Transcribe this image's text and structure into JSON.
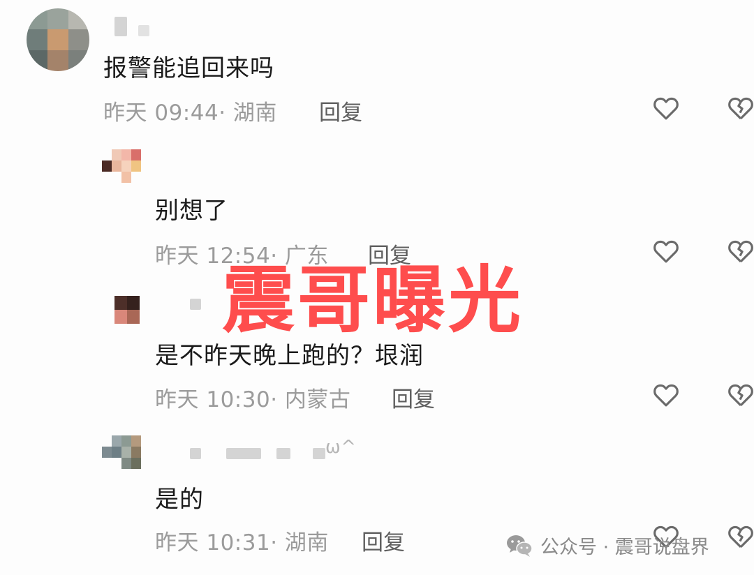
{
  "overlay": {
    "label": "震哥曝光",
    "color": "#ff3b3b"
  },
  "watermark": {
    "icon": "wechat-icon",
    "text": "公众号 · 震哥说盘界"
  },
  "actions": {
    "like_icon": "heart-outline-icon",
    "dislike_icon": "broken-heart-icon"
  },
  "comments": [
    {
      "text": "报警能追回来吗",
      "time": "昨天 09:44",
      "location": "湖南",
      "meta": "昨天 09:44· 湖南",
      "reply_label": "回复",
      "username": ""
    },
    {
      "text": "别想了",
      "time": "昨天 12:54",
      "location": "广东",
      "meta": "昨天 12:54· 广东",
      "reply_label": "回复",
      "username": ""
    },
    {
      "text": "是不昨天晚上跑的？垠润",
      "time": "昨天 10:30",
      "location": "内蒙古",
      "meta": "昨天 10:30· 内蒙古",
      "reply_label": "回复",
      "username": ""
    },
    {
      "text": "是的",
      "time": "昨天 10:31",
      "location": "湖南",
      "meta": "昨天 10:31· 湖南",
      "reply_label": "回复",
      "username": "ω^"
    }
  ]
}
